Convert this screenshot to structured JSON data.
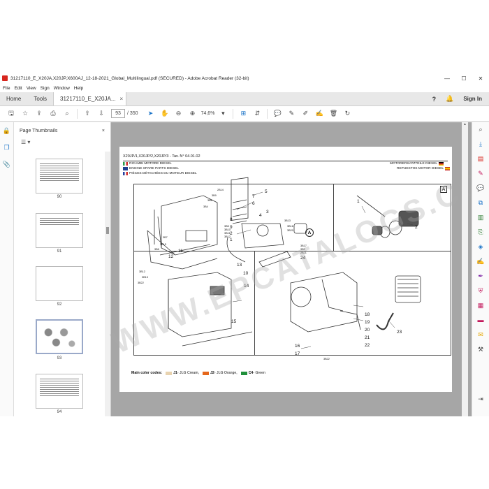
{
  "window": {
    "title": "31217110_E_X20JA,X20JP,X600AJ_12-18-2021_Global_Multilingual.pdf (SECURED) - Adobe Acrobat Reader (32-bit)",
    "minimize": "—",
    "maximize": "☐",
    "close": "✕"
  },
  "menu": [
    "File",
    "Edit",
    "View",
    "Sign",
    "Window",
    "Help"
  ],
  "tabs": {
    "home": "Home",
    "tools": "Tools",
    "document": "31217110_E_X20JA...",
    "document_close": "×",
    "sign_in": "Sign In"
  },
  "toolbar": {
    "current_page": "93",
    "page_count": "/ 350",
    "zoom": "74,6%"
  },
  "thumbnails": {
    "title": "Page Thumbnails",
    "close": "×",
    "pages": [
      {
        "number": "90",
        "kind": "table"
      },
      {
        "number": "91",
        "kind": "table-short"
      },
      {
        "number": "92",
        "kind": "blank"
      },
      {
        "number": "93",
        "kind": "figures",
        "active": true
      },
      {
        "number": "94",
        "kind": "table"
      }
    ]
  },
  "page": {
    "code": "X20JP/1,X20JP/2,X20JP/3 - Tav. N° 04.01.02",
    "lang_it": "RICAMBI MOTORE DIESEL",
    "lang_en": "ENGINE SPARE PARTS DIESEL",
    "lang_fr": "PIÈCES DÉTACHÉES DU MOTEUR DIESEL",
    "lang_de": "MOTORERSATZTEILE DIESEL",
    "lang_es": "REPUESTOS MOTOR DIESEL",
    "detail_label": "A",
    "callouts_main": [
      "5",
      "7",
      "6",
      "4",
      "3",
      "8",
      "9",
      "2",
      "1",
      "11",
      "12",
      "10",
      "13",
      "24"
    ],
    "callouts_detail_a": [
      "1",
      "2"
    ],
    "callouts_lower_left": [
      "14",
      "15"
    ],
    "callouts_lower_right": [
      "18",
      "19",
      "20",
      "21",
      "22",
      "23",
      "16",
      "17"
    ],
    "small_callouts": [
      "2B14",
      "3B9",
      "3B8",
      "3B4",
      "3B5",
      "3B10",
      "3B11",
      "3B12",
      "3B13",
      "3B16",
      "3B20",
      "3B15",
      "3B6",
      "3B7",
      "3B12",
      "3B13",
      "3B22",
      "3B17",
      "3B2",
      "2B21",
      "3B22",
      "3B19",
      "3B3",
      "3B5",
      "3B6",
      "3B20",
      "3B15",
      "3B16",
      "3B4",
      "3B15"
    ],
    "color_codes_label": "Main color codes:",
    "colors": [
      {
        "code": "J1",
        "name": " - JLG Cream,",
        "hex": "#e8d3b0"
      },
      {
        "code": "J2",
        "name": " - JLG Orange,",
        "hex": "#e5671b"
      },
      {
        "code": "C4",
        "name": " - Green",
        "hex": "#1f8f3a"
      }
    ],
    "watermark": "WWW.EPCATALOGS.COM"
  }
}
